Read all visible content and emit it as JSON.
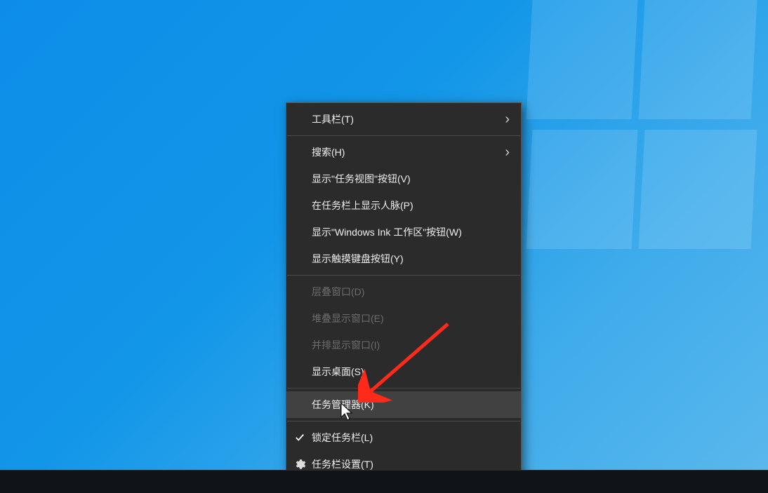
{
  "menu": {
    "items": [
      {
        "label": "工具栏(T)",
        "type": "submenu",
        "enabled": true
      },
      {
        "type": "sep"
      },
      {
        "label": "搜索(H)",
        "type": "submenu",
        "enabled": true
      },
      {
        "label": "显示\"任务视图\"按钮(V)",
        "type": "normal",
        "enabled": true
      },
      {
        "label": "在任务栏上显示人脉(P)",
        "type": "normal",
        "enabled": true
      },
      {
        "label": "显示\"Windows Ink 工作区\"按钮(W)",
        "type": "normal",
        "enabled": true
      },
      {
        "label": "显示触摸键盘按钮(Y)",
        "type": "normal",
        "enabled": true
      },
      {
        "type": "sep"
      },
      {
        "label": "层叠窗口(D)",
        "type": "normal",
        "enabled": false
      },
      {
        "label": "堆叠显示窗口(E)",
        "type": "normal",
        "enabled": false
      },
      {
        "label": "并排显示窗口(I)",
        "type": "normal",
        "enabled": false
      },
      {
        "label": "显示桌面(S)",
        "type": "normal",
        "enabled": true
      },
      {
        "type": "sep"
      },
      {
        "label": "任务管理器(K)",
        "type": "normal",
        "enabled": true,
        "hovered": true
      },
      {
        "type": "sep"
      },
      {
        "label": "锁定任务栏(L)",
        "type": "check",
        "enabled": true,
        "checked": true
      },
      {
        "label": "任务栏设置(T)",
        "type": "gear",
        "enabled": true
      }
    ]
  },
  "annotation": {
    "arrow_color": "#ff2a1a"
  }
}
